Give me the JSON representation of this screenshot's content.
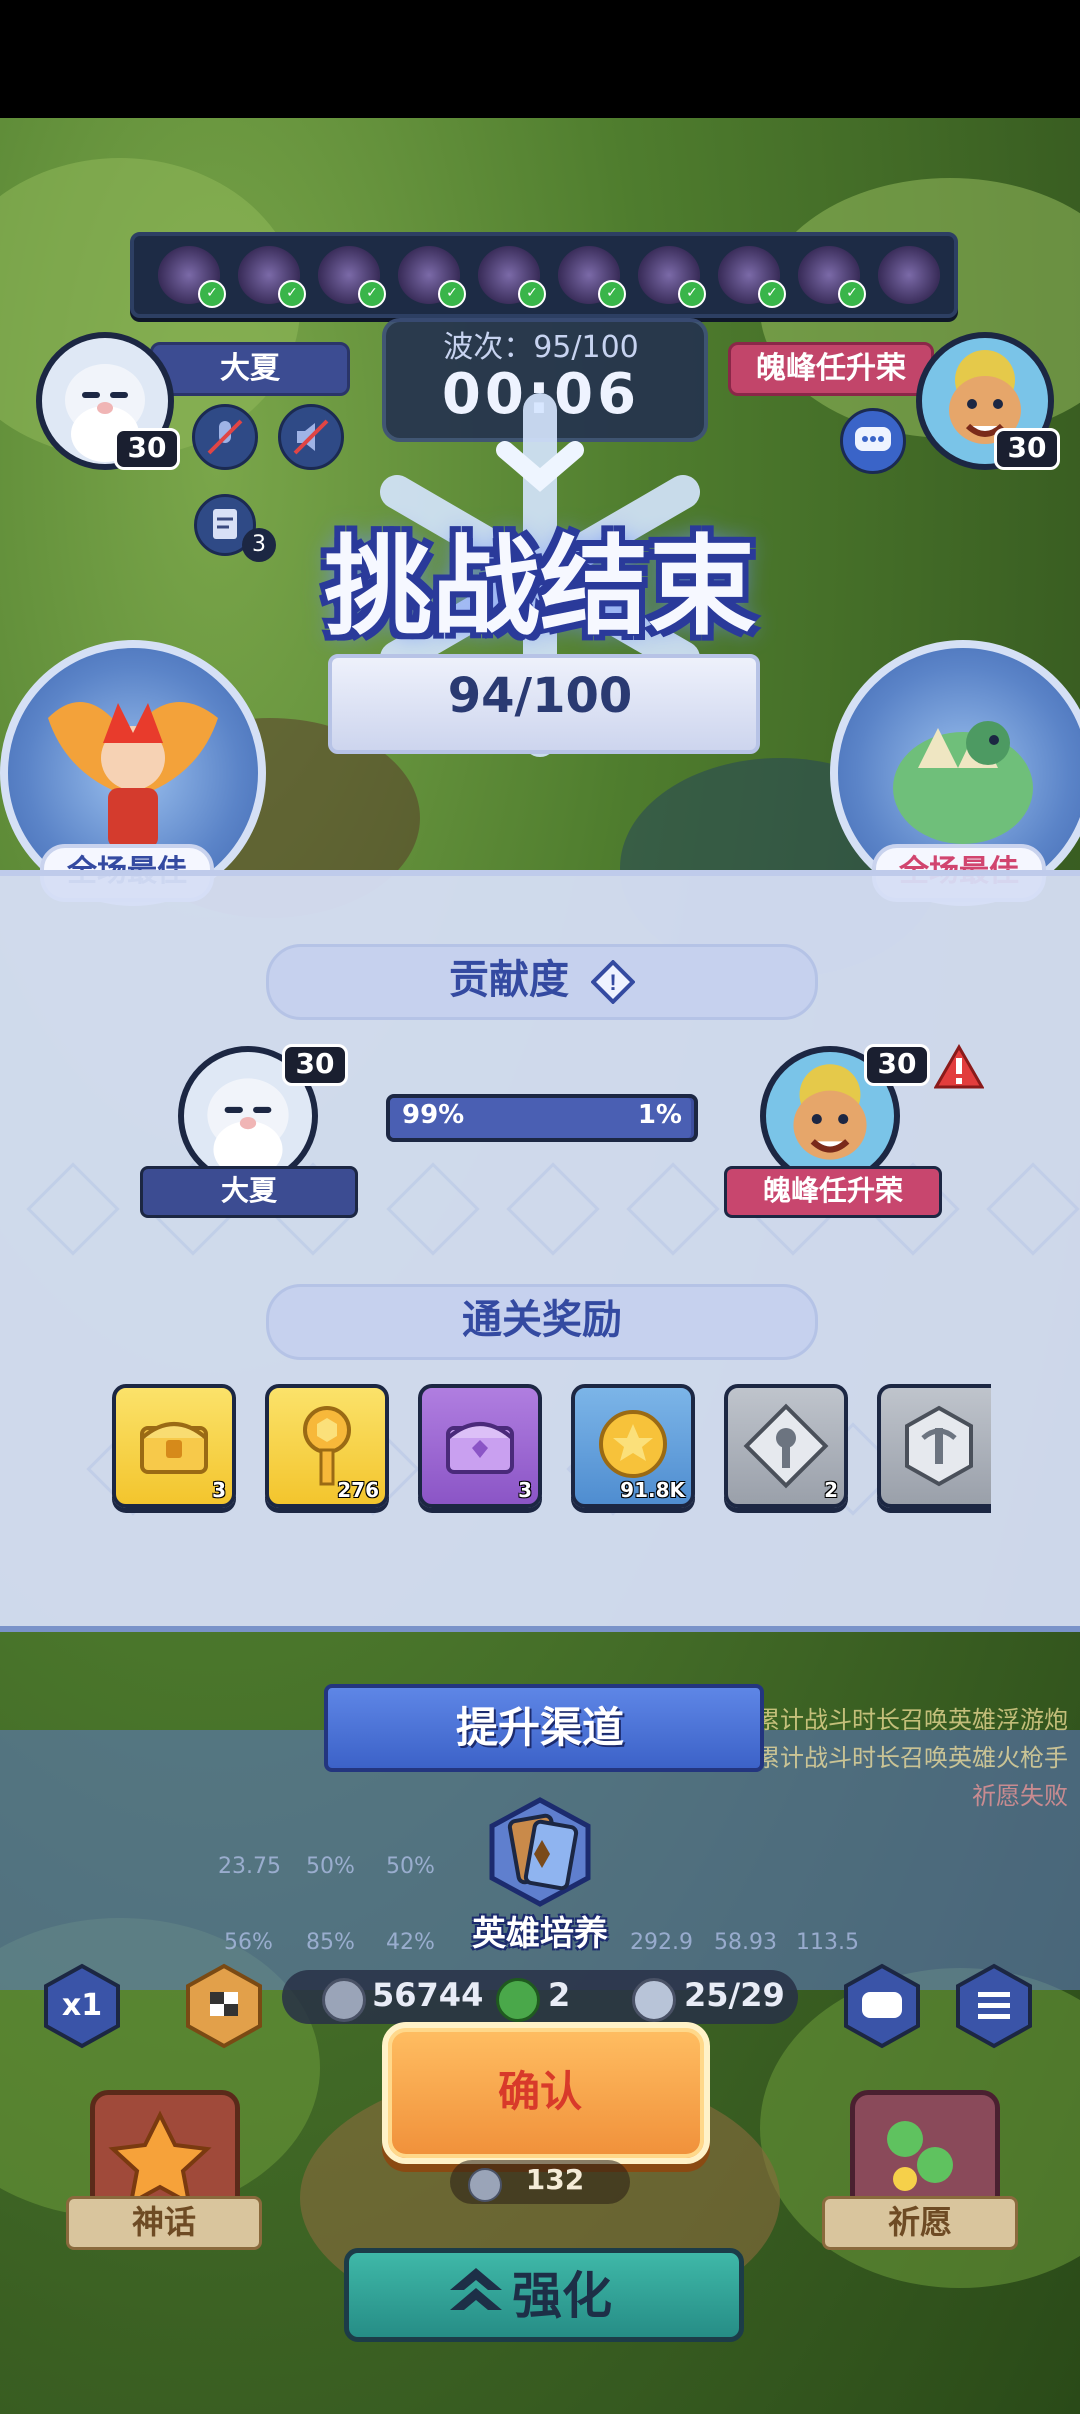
{
  "colors": {
    "accent_blue": "#344aa1",
    "accent_pink": "#d1456f",
    "confirm_orange": "#f0903a",
    "confirm_text": "#d83a2a",
    "enhance_teal": "#268d86"
  },
  "match": {
    "wave": "波次：95/100",
    "timer": "00:06",
    "player1": {
      "name": "大夏",
      "level": "30"
    },
    "player2": {
      "name": "魄峰任升荣",
      "level": "30"
    },
    "small_count": "3"
  },
  "result": {
    "title": "挑战结束",
    "score": "94/100",
    "best_label_left": "全场最佳",
    "best_label_right": "全场最佳"
  },
  "contribution": {
    "header": "贡献度",
    "player1_name": "大夏",
    "player1_level": "30",
    "player2_name": "魄峰任升荣",
    "player2_level": "30",
    "player1_percent": "99%",
    "player2_percent": "1%",
    "player1_fraction": 0.99
  },
  "rewards": {
    "header": "通关奖励",
    "items": [
      {
        "icon": "gold-chest-icon",
        "count": "3"
      },
      {
        "icon": "gold-key-icon",
        "count": "276"
      },
      {
        "icon": "purple-chest-icon",
        "count": "3"
      },
      {
        "icon": "gold-coin-icon",
        "count": "91.8K"
      },
      {
        "icon": "silver-emblem-icon",
        "count": "2"
      },
      {
        "icon": "silver-emblem-icon",
        "count": ""
      }
    ]
  },
  "upgrade": {
    "banner": "提升渠道",
    "hero_training": "英雄培养"
  },
  "side_messages": {
    "line1": "累计战斗时长召唤英雄浮游炮",
    "line2": "累计战斗时长召唤英雄火枪手",
    "line3": "祈愿失败"
  },
  "ghost_stats": [
    "23.75",
    "50%",
    "50%",
    "56%",
    "85%",
    "42%",
    "292.9",
    "58.93",
    "113.5"
  ],
  "bottom": {
    "speed": "x1",
    "coins": "56744",
    "clover": "2",
    "population": "25/29",
    "confirm": "确认",
    "cost": "132",
    "myth": "神话",
    "wish": "祈愿",
    "enhance": "强化"
  }
}
